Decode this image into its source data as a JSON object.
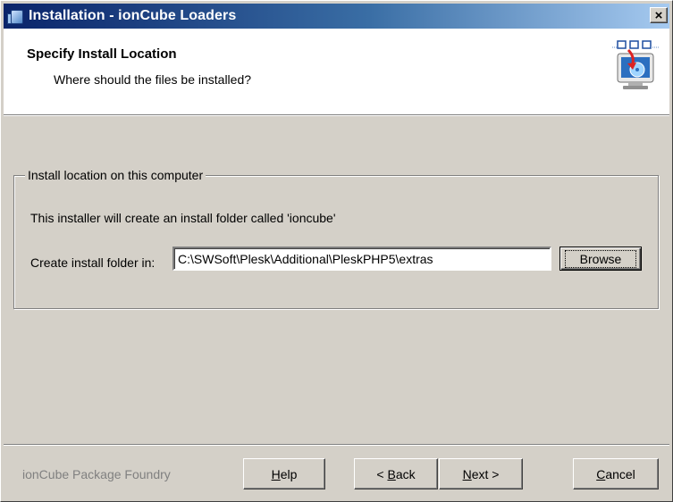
{
  "window": {
    "title": "Installation - ionCube Loaders",
    "close_glyph": "×"
  },
  "header": {
    "title": "Specify Install Location",
    "subtitle": "Where should the files be installed?",
    "graphic_icon": "install-location-icon"
  },
  "group": {
    "legend": "Install location on this computer",
    "description": "This installer will create an install folder called 'ioncube'",
    "folder_label": "Create install folder in:",
    "folder_value": "C:\\SWSoft\\Plesk\\Additional\\PleskPHP5\\extras",
    "browse_label": "Browse"
  },
  "footer": {
    "brand": "ionCube Package Foundry",
    "help_mnemonic": "H",
    "help_rest": "elp",
    "back_prefix": "< ",
    "back_mnemonic": "B",
    "back_rest": "ack",
    "next_mnemonic": "N",
    "next_rest": "ext >",
    "cancel_mnemonic": "C",
    "cancel_rest": "ancel"
  },
  "colors": {
    "titlebar_start": "#0a246a",
    "titlebar_end": "#a6caf0",
    "dialog_bg": "#d4d0c8"
  }
}
